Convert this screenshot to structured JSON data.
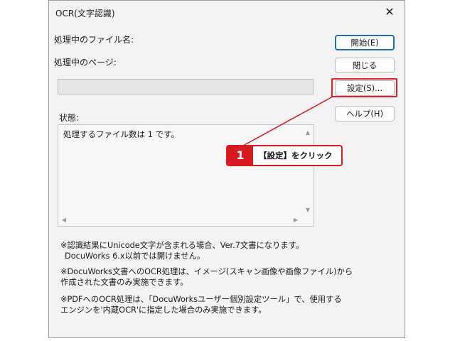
{
  "window": {
    "title": "OCR(文字認識)",
    "close_symbol": "✕"
  },
  "labels": {
    "processing_file": "処理中のファイル名:",
    "processing_page": "処理中のページ:",
    "status": "状態:"
  },
  "buttons": {
    "start": "開始(E)",
    "close": "閉じる",
    "settings": "設定(S)...",
    "help": "ヘルプ(H)"
  },
  "progress": {
    "value": 0
  },
  "status_box": {
    "text": "処理するファイル数は 1 です。",
    "scroll_up": "▲",
    "scroll_down": "▼",
    "scroll_left": "◀",
    "scroll_right": "▶"
  },
  "notes": {
    "note1_line1": "※認識結果にUnicode文字が含まれる場合、Ver.7文書になります。",
    "note1_line2": "DocuWorks 6.x以前では開けません。",
    "note2_line1": "※DocuWorks文書へのOCR処理は、イメージ(スキャン画像や画像ファイル)から",
    "note2_line2": "作成された文書のみ実施できます。",
    "note3_line1": "※PDFへのOCR処理は、「DocuWorksユーザー個別設定ツール」で、使用する",
    "note3_line2": "エンジンを'内蔵OCR'に指定した場合のみ実施できます。"
  },
  "annotation": {
    "step_number": "1",
    "instruction": "【設定】をクリック",
    "color": "#d71920"
  }
}
